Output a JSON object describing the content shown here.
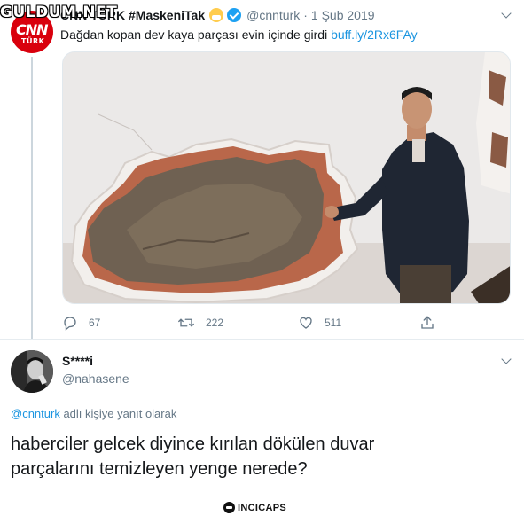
{
  "watermark": "GULDUM.NET",
  "tweet1": {
    "avatar_lines": [
      "CNN",
      "TÜRK"
    ],
    "name": "CNN TÜRK #MaskeniTak",
    "handle": "@cnnturk",
    "date": "1 Şub 2019",
    "text": "Dağdan kopan dev kaya parçası evin içinde girdi",
    "link": "buff.ly/2Rx6FAy",
    "stats": {
      "replies": "67",
      "retweets": "222",
      "likes": "511"
    }
  },
  "tweet2": {
    "name": "S****i",
    "handle": "@nahasene",
    "reply_to_mention": "@cnnturk",
    "reply_to_text": "adlı kişiye yanıt olarak",
    "text": "haberciler gelcek diyince kırılan dökülen duvar parçalarını temizleyen yenge nerede?"
  },
  "brand": "INCICAPS",
  "colors": {
    "accent": "#1da1f2",
    "link": "#1b95e0",
    "muted": "#657786",
    "cnn_red": "#d9000d"
  }
}
